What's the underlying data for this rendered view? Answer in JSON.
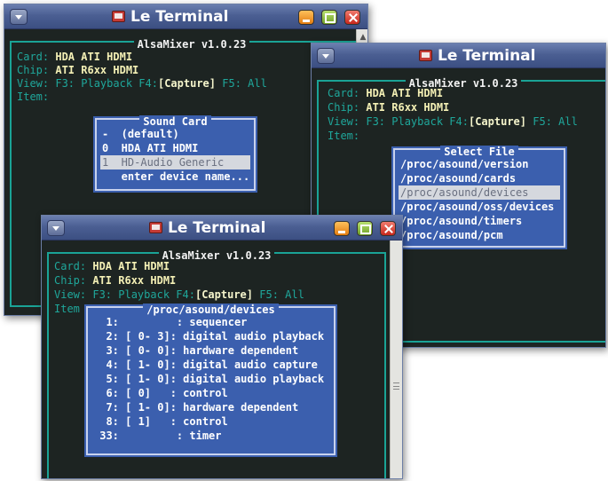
{
  "windows": [
    {
      "title": "Le Terminal",
      "mixer_title": "AlsaMixer v1.0.23",
      "card_label": "Card:",
      "card_value": "HDA ATI HDMI",
      "chip_label": "Chip:",
      "chip_value": "ATI R6xx HDMI",
      "view_label": "View:",
      "view_playback": "F3: Playback",
      "view_f4": "F4:",
      "view_capture": "[Capture]",
      "view_all": "F5: All",
      "item_label": "Item:",
      "dialog": {
        "title": "Sound Card",
        "items": [
          "-  (default)",
          "0  HDA ATI HDMI",
          "1  HD-Audio Generic",
          "   enter device name..."
        ]
      }
    },
    {
      "title": "Le Terminal",
      "mixer_title": "AlsaMixer v1.0.23",
      "card_label": "Card:",
      "card_value": "HDA ATI HDMI",
      "chip_label": "Chip:",
      "chip_value": "ATI R6xx HDMI",
      "view_label": "View:",
      "view_playback": "F3: Playback",
      "view_f4": "F4:",
      "view_capture": "[Capture]",
      "view_all": "F5: All",
      "item_label": "Item:",
      "dialog": {
        "title": "Select File",
        "items": [
          "/proc/asound/version",
          "/proc/asound/cards",
          "/proc/asound/devices",
          "/proc/asound/oss/devices",
          "/proc/asound/timers",
          "/proc/asound/pcm"
        ]
      }
    },
    {
      "title": "Le Terminal",
      "mixer_title": "AlsaMixer v1.0.23",
      "card_label": "Card:",
      "card_value": "HDA ATI HDMI",
      "chip_label": "Chip:",
      "chip_value": "ATI R6xx HDMI",
      "view_label": "View:",
      "view_playback": "F3: Playback",
      "view_f4": "F4:",
      "view_capture": "[Capture]",
      "view_all": "F5: All",
      "item_label": "Item",
      "dialog": {
        "title": "/proc/asound/devices",
        "items": [
          "  1:         : sequencer",
          "  2: [ 0- 3]: digital audio playback",
          "  3: [ 0- 0]: hardware dependent",
          "  4: [ 1- 0]: digital audio capture",
          "  5: [ 1- 0]: digital audio playback",
          "  6: [ 0]   : control",
          "  7: [ 1- 0]: hardware dependent",
          "  8: [ 1]   : control",
          " 33:         : timer"
        ]
      }
    }
  ],
  "colors": {
    "terminal_bg": "#1d2422",
    "frame": "#1aa396",
    "dialog_bg": "#3b5fae",
    "value_text": "#f4f0b5",
    "titlebar": "#4b5f93"
  }
}
